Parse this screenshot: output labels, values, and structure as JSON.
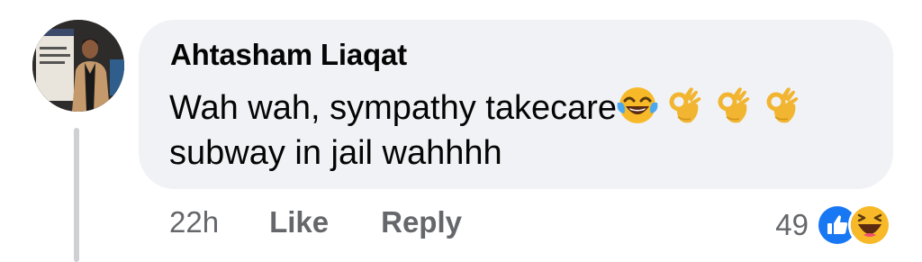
{
  "comment": {
    "author": "Ahtasham Liaqat",
    "text_line1": "Wah wah, sympathy takecare",
    "text_line2": "subway in jail wahhhh",
    "emojis": [
      "face-with-tears-of-joy-icon",
      "ok-hand-icon",
      "ok-hand-icon",
      "ok-hand-icon"
    ]
  },
  "actions": {
    "timestamp": "22h",
    "like_label": "Like",
    "reply_label": "Reply"
  },
  "reactions": {
    "count": "49",
    "icons": [
      "like-reaction-icon",
      "haha-reaction-icon"
    ]
  },
  "colors": {
    "bubble": "#f0f2f5",
    "meta_text": "#65676b",
    "like_blue": "#1877f2"
  }
}
